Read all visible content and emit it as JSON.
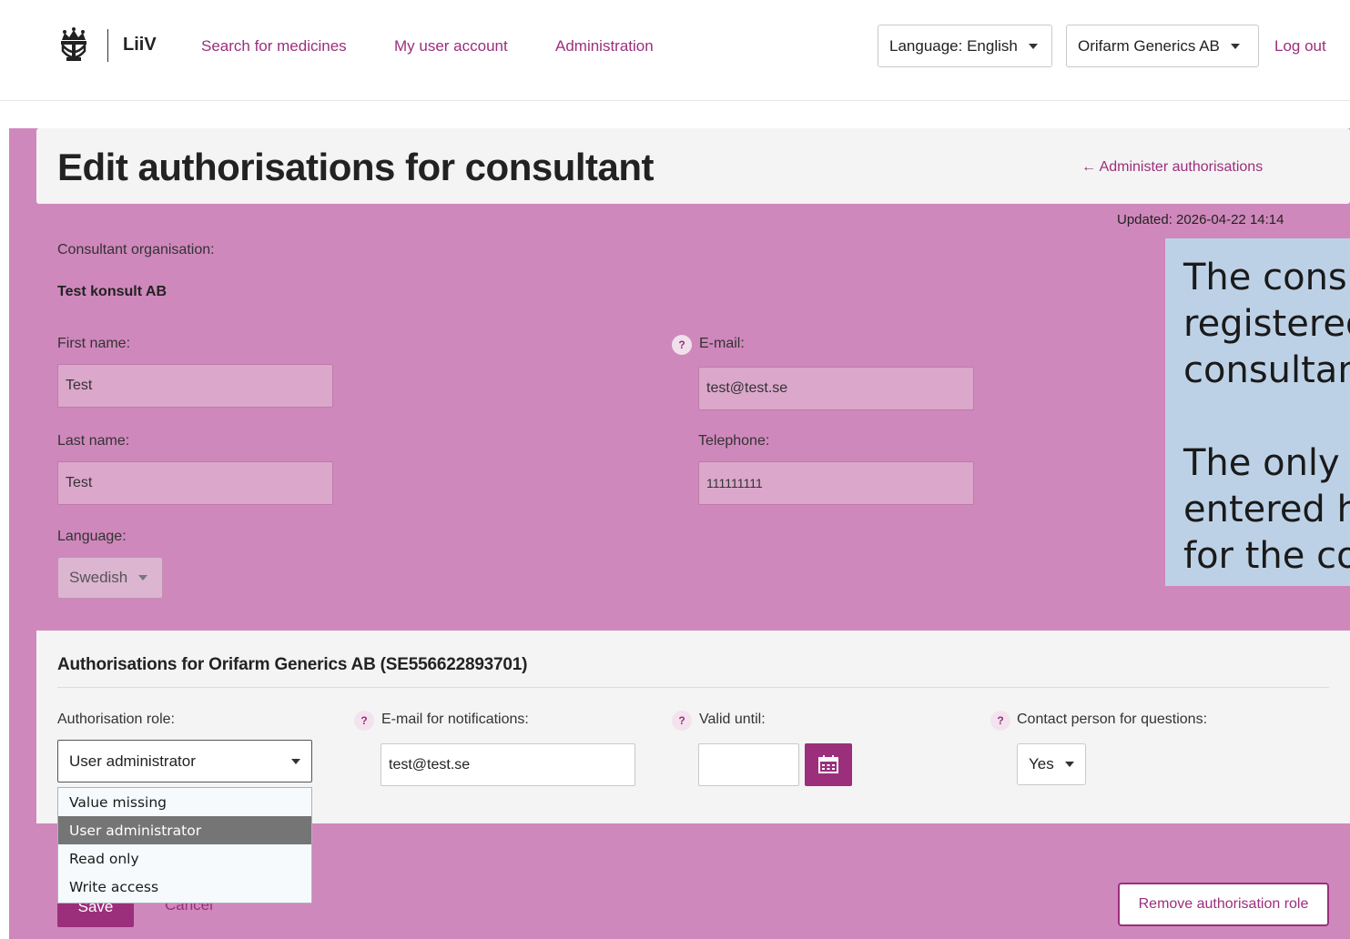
{
  "header": {
    "brand": "LiiV",
    "nav": [
      "Search for medicines",
      "My user account",
      "Administration"
    ],
    "language_dropdown": "Language: English",
    "organisation_dropdown": "Orifarm Generics AB",
    "logout": "Log out"
  },
  "page": {
    "title": "Edit authorisations for consultant",
    "back_link": "← Administer authorisations",
    "updated": "Updated: 2026-04-22 14:14"
  },
  "consultant": {
    "org_label": "Consultant organisation:",
    "org_value": "Test konsult AB",
    "first_name_label": "First name:",
    "first_name_value": "Test",
    "last_name_label": "Last name:",
    "last_name_value": "Test",
    "email_label": "E-mail:",
    "email_value": "test@test.se",
    "telephone_label": "Telephone:",
    "telephone_value": "111111111",
    "language_label": "Language:",
    "language_value": "Swedish"
  },
  "tooltip": {
    "text": "The consu\nregistered\nconsultan\n\nThe only i\nentered he\nfor the co"
  },
  "authorisations": {
    "title": "Authorisations for Orifarm Generics AB (SE556622893701)",
    "role_label": "Authorisation role:",
    "role_value": "User administrator",
    "notify_label": "E-mail for notifications:",
    "notify_value": "test@test.se",
    "valid_label": "Valid until:",
    "valid_value": "",
    "contact_label": "Contact person for questions:",
    "contact_value": "Yes",
    "role_options": [
      "Value missing",
      "User administrator",
      "Read only",
      "Write access"
    ],
    "help_glyph": "?"
  },
  "actions": {
    "save": "Save",
    "cancel": "Cancel",
    "remove": "Remove authorisation role"
  }
}
